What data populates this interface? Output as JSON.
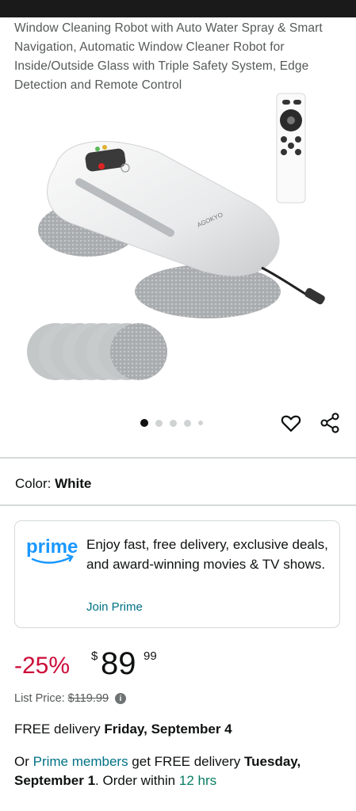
{
  "product": {
    "title": "Window Cleaning Robot with Auto Water Spray & Smart Navigation, Automatic Window Cleaner Robot for Inside/Outside Glass with Triple Safety System, Edge Detection and Remote Control",
    "brand_on_device": "AGOKYO",
    "image_dots": {
      "count": 5,
      "active_index": 0
    }
  },
  "color": {
    "label": "Color:",
    "value": "White"
  },
  "prime": {
    "logo_text": "prime",
    "message": "Enjoy fast, free delivery, exclusive deals, and award-winning movies & TV shows.",
    "join_label": "Join Prime"
  },
  "price": {
    "discount": "-25%",
    "currency": "$",
    "whole": "89",
    "fraction": "99",
    "list_label": "List Price:",
    "list_value": "$119.99"
  },
  "delivery": {
    "prefix": "FREE delivery ",
    "date": "Friday, September 4"
  },
  "prime_delivery": {
    "or": "Or ",
    "members_link": "Prime members",
    "mid": " get FREE delivery ",
    "date": "Tuesday, September 1",
    "suffix": ". Order within ",
    "countdown": "12 hrs"
  },
  "colors": {
    "accent_link": "#007185",
    "discount": "#cc0c39",
    "prime_blue": "#1a98ff"
  }
}
